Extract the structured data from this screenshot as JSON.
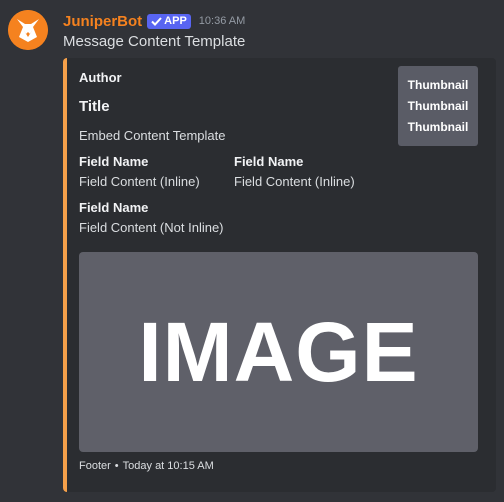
{
  "message": {
    "username": "JuniperBot",
    "badge": {
      "icon": "checkmark-icon",
      "label": "APP"
    },
    "timestamp": "10:36 AM",
    "content": "Message Content Template",
    "avatar_icon": "fox-logo"
  },
  "embed": {
    "accent_color": "#f5a04a",
    "author": "Author",
    "title": "Title",
    "description": "Embed Content Template",
    "thumbnail": [
      "Thumbnail",
      "Thumbnail",
      "Thumbnail"
    ],
    "fields": [
      {
        "name": "Field Name",
        "value": "Field Content (Inline)"
      },
      {
        "name": "Field Name",
        "value": "Field Content (Inline)"
      },
      {
        "name": "Field Name",
        "value": "Field Content (Not Inline)"
      }
    ],
    "image_text": "IMAGE",
    "footer": {
      "text": "Footer",
      "separator": "•",
      "timestamp": "Today at 10:15 AM"
    }
  },
  "colors": {
    "background": "#313338",
    "embed_background": "#2b2d31",
    "username": "#f5821f",
    "badge": "#5865f2"
  }
}
